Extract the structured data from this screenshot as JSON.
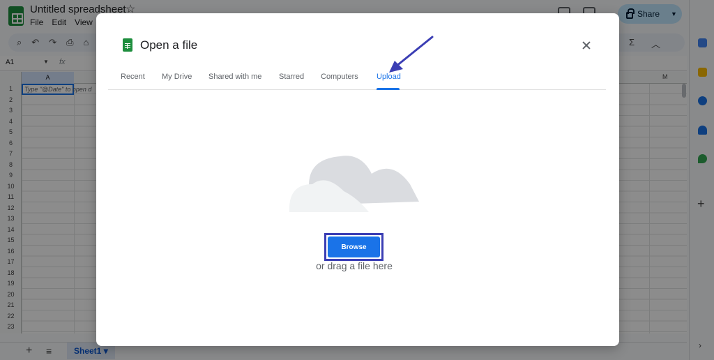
{
  "app": {
    "doc_title": "Untitled spreadsheet",
    "menu": [
      "File",
      "Edit",
      "View"
    ],
    "share_label": "Share",
    "namebox": "A1",
    "fx_label": "fx",
    "column_a": "A",
    "column_m": "M",
    "rows": [
      "1",
      "2",
      "3",
      "4",
      "5",
      "6",
      "7",
      "8",
      "9",
      "10",
      "11",
      "12",
      "13",
      "14",
      "15",
      "16",
      "17",
      "18",
      "19",
      "20",
      "21",
      "22",
      "23"
    ],
    "cell_a1_placeholder": "Type \"@Date\" to open d",
    "sheet_tab": "Sheet1"
  },
  "dialog": {
    "title": "Open a file",
    "tabs": [
      "Recent",
      "My Drive",
      "Shared with me",
      "Starred",
      "Computers",
      "Upload"
    ],
    "active_tab": "Upload",
    "browse_label": "Browse",
    "drag_hint": "or drag a file here"
  },
  "colors": {
    "accent": "#1a73e8",
    "annotation": "#3b3eb4",
    "sheets_green": "#1e8e3e"
  }
}
